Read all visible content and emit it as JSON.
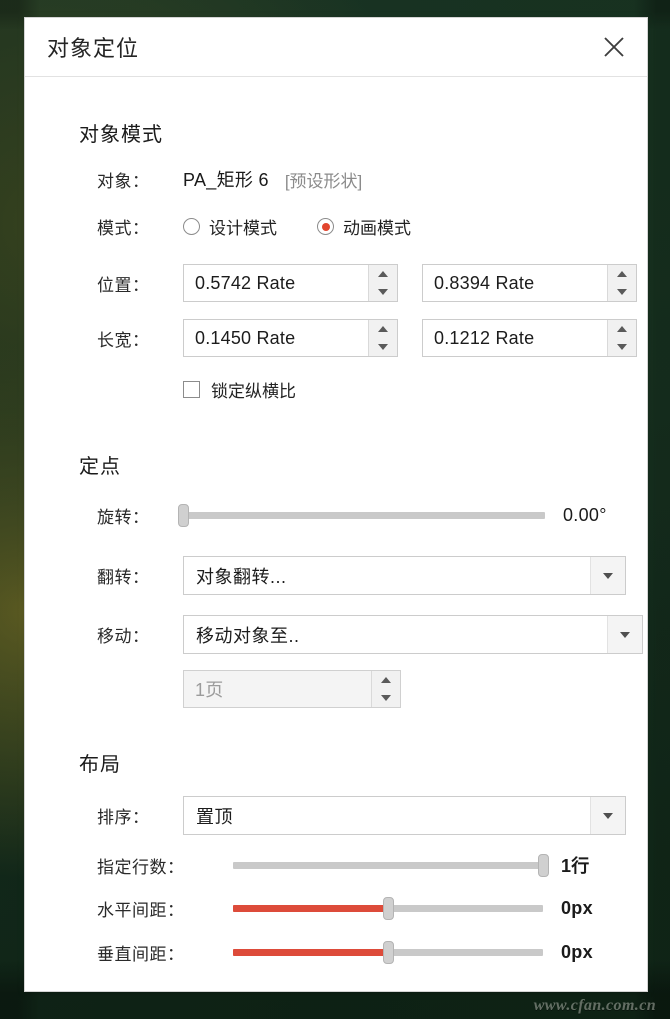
{
  "window": {
    "title": "对象定位",
    "close_icon": "close-icon"
  },
  "watermark": "www.cfan.com.cn",
  "colors": {
    "accent_red": "#dd4b3a",
    "radio_dot": "#e2452e",
    "backdrop_green": "#1f4230",
    "track_grey": "#c9c9c9"
  },
  "sections": {
    "object_mode": {
      "heading": "对象模式",
      "object_row": {
        "label": "对象：",
        "name": "PA_矩形 6",
        "type": "[预设形状]"
      },
      "mode_row": {
        "label": "模式：",
        "options": [
          {
            "label": "设计模式",
            "selected": false
          },
          {
            "label": "动画模式",
            "selected": true
          }
        ]
      },
      "position_row": {
        "label": "位置：",
        "x_value": "0.5742 Rate",
        "y_value": "0.8394 Rate"
      },
      "size_row": {
        "label": "长宽：",
        "w_value": "0.1450 Rate",
        "h_value": "0.1212 Rate"
      },
      "lock_ratio": {
        "label": "锁定纵横比",
        "checked": false
      }
    },
    "anchor": {
      "heading": "定点",
      "rotate_row": {
        "label": "旋转：",
        "value": "0.00°",
        "handle_percent": 0,
        "fill_percent": 0
      },
      "flip_row": {
        "label": "翻转：",
        "value": "对象翻转..."
      },
      "move_row": {
        "label": "移动：",
        "value": "移动对象至.."
      },
      "page_spinner": {
        "value": "1页",
        "disabled": true
      }
    },
    "layout": {
      "heading": "布局",
      "order_row": {
        "label": "排序：",
        "value": "置顶"
      },
      "rows_row": {
        "label": "指定行数：",
        "value": "1行",
        "handle_percent": 100,
        "fill_percent": 0
      },
      "hgap_row": {
        "label": "水平间距：",
        "value": "0px",
        "handle_percent": 50,
        "fill_percent": 50
      },
      "vgap_row": {
        "label": "垂直间距：",
        "value": "0px",
        "handle_percent": 50,
        "fill_percent": 50
      }
    }
  }
}
